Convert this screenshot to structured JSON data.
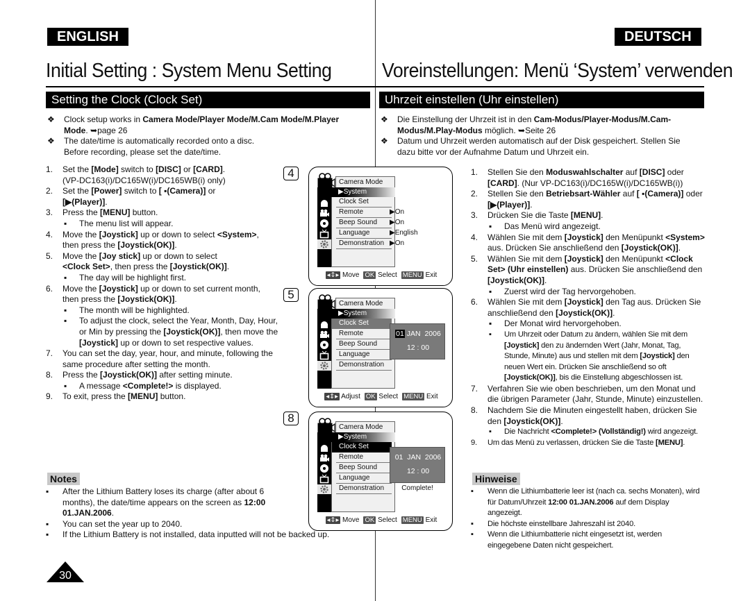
{
  "header": {
    "lang_left": "ENGLISH",
    "lang_right": "DEUTSCH",
    "title_en": "Initial Setting : System Menu Setting",
    "title_de": "Voreinstellungen: Menü ‘System’ verwenden",
    "section_en": "Setting the Clock (Clock Set)",
    "section_de": "Uhrzeit einstellen (Uhr einstellen)"
  },
  "en": {
    "intro": [
      {
        "pre": "Clock setup works in ",
        "bold": "Camera Mode/Player Mode/M.Cam Mode/M.Player Mode",
        "post": ". ➥page 26"
      },
      {
        "line1": "The date/time is automatically recorded onto a disc.",
        "line2": "Before recording, please set the date/time."
      }
    ],
    "steps": {
      "s1": {
        "num": "1.",
        "a": "Set the ",
        "b": "[Mode]",
        "c": " switch to ",
        "d": "[DISC]",
        "e": " or ",
        "f": "[CARD]",
        "g": ".",
        "line2": "(VP-DC163(i)/DC165W(i)/DC165WB(i) only)"
      },
      "s2": {
        "num": "2.",
        "a": "Set the ",
        "b": "[Power]",
        "c": " switch to ",
        "d": "[ ▪(Camera)]",
        "e": " or",
        "line2": "[▶(Player)]",
        "line2_post": "."
      },
      "s3": {
        "num": "3.",
        "a": "Press the ",
        "b": "[MENU]",
        "c": " button.",
        "sub": "The menu list will appear."
      },
      "s4": {
        "num": "4.",
        "a": "Move the ",
        "b": "[Joystick]",
        "c": " up or down to select ",
        "d": "<System>",
        "e": ",",
        "line2a": "then press the ",
        "line2b": "[Joystick(OK)]",
        "line2c": "."
      },
      "s5": {
        "num": "5.",
        "a": "Move the ",
        "b": "[Joy stick]",
        "c": " up or down to select",
        "line2a": "<Clock Set>",
        "line2b": ", then press the ",
        "line2c": "[Joystick(OK)]",
        "line2d": ".",
        "sub": "The day will be highlight first."
      },
      "s6": {
        "num": "6.",
        "a": "Move the ",
        "b": "[Joystick]",
        "c": " up or down to set current month,",
        "line2a": "then press the ",
        "line2b": "[Joystick(OK)]",
        "line2c": ".",
        "sub1": "The month will be highlighted.",
        "sub2a": "To adjust the clock, select the Year, Month, Day, Hour, or Min by pressing the ",
        "sub2b": "[Joystick(OK)]",
        "sub2c": ", then move the ",
        "sub2d": "[Joystick]",
        "sub2e": " up or down to set respective values."
      },
      "s7": {
        "num": "7.",
        "text": "You can set the day, year, hour, and minute, following the same procedure after setting the month."
      },
      "s8": {
        "num": "8.",
        "a": "Press the ",
        "b": "[Joystick(OK)]",
        "c": " after setting minute.",
        "suba": "A message ",
        "subb": "<Complete!>",
        "subc": " is displayed."
      },
      "s9": {
        "num": "9.",
        "a": "To exit, press the ",
        "b": "[MENU]",
        "c": " button."
      }
    },
    "notes_label": "Notes",
    "notes": {
      "n1a": "After the Lithium Battery loses its charge (after about 6 months), the date/time appears on the screen as ",
      "n1b": "12:00 01.JAN.2006",
      "n1c": ".",
      "n2": "You can set the year up to 2040.",
      "n3": "If the Lithium Battery is not installed, data inputted will not be backed up."
    }
  },
  "de": {
    "intro": [
      {
        "pre": "Die Einstellung der Uhrzeit ist in den ",
        "bold": "Cam-Modus/Player-Modus/M.Cam-Modus/M.Play-Modus",
        "post": " möglich. ➥Seite 26"
      },
      {
        "text": "Datum und Uhrzeit werden automatisch auf der Disk gespeichert. Stellen Sie dazu bitte vor der Aufnahme Datum und Uhrzeit ein."
      }
    ],
    "steps": {
      "s1": {
        "num": "1.",
        "a": "Stellen Sie den ",
        "b": "Moduswahlschalter",
        "c": " auf ",
        "d": "[DISC]",
        "e": " oder ",
        "f": "[CARD]",
        "g": ". (Nur VP-DC163(i)/DC165W(i)/DC165WB(i))"
      },
      "s2": {
        "num": "2.",
        "a": "Stellen Sie den ",
        "b": "Betriebsart-Wähler",
        "c": " auf ",
        "d": "[ ▪(Camera)]",
        "e": " oder ",
        "f": "[▶(Player)]",
        "g": "."
      },
      "s3": {
        "num": "3.",
        "a": "Drücken Sie die Taste ",
        "b": "[MENU]",
        "c": ".",
        "sub": "Das Menü wird angezeigt."
      },
      "s4": {
        "num": "4.",
        "a": "Wählen Sie mit dem ",
        "b": "[Joystick]",
        "c": " den Menüpunkt ",
        "d": "<System>",
        "e": " aus. Drücken Sie anschließend den ",
        "f": "[Joystick(OK)]",
        "g": "."
      },
      "s5": {
        "num": "5.",
        "a": "Wählen Sie mit dem ",
        "b": "[Joystick]",
        "c": " den Menüpunkt ",
        "d": "<Clock Set> (Uhr einstellen)",
        "e": " aus. Drücken Sie anschließend den ",
        "f": "[Joystick(OK)]",
        "g": ".",
        "sub": "Zuerst wird der Tag hervorgehoben."
      },
      "s6": {
        "num": "6.",
        "a": "Wählen Sie mit dem ",
        "b": "[Joystick]",
        "c": " den Tag aus. Drücken Sie anschließend den ",
        "d": "[Joystick(OK)]",
        "e": ".",
        "sub1": "Der Monat wird hervorgehoben.",
        "sub2a": "Um Uhrzeit oder Datum zu ändern, wählen Sie mit dem ",
        "sub2b": "[Joystick]",
        "sub2c": " den zu ändernden Wert (Jahr, Monat, Tag, Stunde, Minute) aus und stellen mit dem ",
        "sub2d": "[Joystick]",
        "sub2e": " den neuen Wert ein. Drücken Sie anschließend so oft ",
        "sub2f": "[Joystick(OK)]",
        "sub2g": ", bis die Einstellung abgeschlossen ist."
      },
      "s7": {
        "num": "7.",
        "text": "Verfahren Sie wie oben beschrieben, um den Monat und die übrigen Parameter (Jahr, Stunde, Minute) einzustellen."
      },
      "s8": {
        "num": "8.",
        "a": "Nachdem Sie die Minuten eingestellt haben, drücken Sie den ",
        "b": "[Joystick(OK)]",
        "c": ".",
        "suba": "Die Nachricht ",
        "subb": "<Complete!> (Vollständig!)",
        "subc": " wird angezeigt."
      },
      "s9": {
        "num": "9.",
        "a": "Um das Menü zu verlassen, drücken Sie die Taste ",
        "b": "[MENU]",
        "c": "."
      }
    },
    "notes_label": "Hinweise",
    "notes": {
      "n1a": "Wenn die Lithiumbatterie leer ist (nach ca. sechs Monaten), wird für Datum/Uhrzeit ",
      "n1b": "12:00 01.JAN.2006",
      "n1c": " auf dem Display angezeigt.",
      "n2": "Die höchste einstellbare Jahreszahl ist 2040.",
      "n3": "Wenn die Lithiumbatterie nicht eingesetzt ist, werden eingegebene Daten nicht gespeichert."
    }
  },
  "screens": [
    {
      "step": "4",
      "mode": "Camera Mode",
      "section": "System",
      "items": [
        "Clock Set",
        "Remote",
        "Beep Sound",
        "Language",
        "Demonstration"
      ],
      "values": [
        "On",
        "On",
        "English",
        "On"
      ],
      "footer": {
        "nav": "Move",
        "ok_key": "OK",
        "ok": "Select",
        "menu_key": "MENU",
        "menu": "Exit"
      }
    },
    {
      "step": "5",
      "mode": "Camera Mode",
      "section": "System",
      "items": [
        "Clock Set",
        "Remote",
        "Beep Sound",
        "Language",
        "Demonstration"
      ],
      "clock": {
        "day": "01",
        "month": "JAN",
        "year": "2006",
        "time": "12 : 00"
      },
      "footer": {
        "nav": "Adjust",
        "ok_key": "OK",
        "ok": "Select",
        "menu_key": "MENU",
        "menu": "Exit"
      }
    },
    {
      "step": "8",
      "mode": "Camera Mode",
      "section": "System",
      "items": [
        "Clock Set",
        "Remote",
        "Beep Sound",
        "Language",
        "Demonstration"
      ],
      "clock": {
        "date": "01  JAN  2006",
        "time": "12 : 00"
      },
      "message": "Complete!",
      "footer": {
        "nav": "Move",
        "ok_key": "OK",
        "ok": "Select",
        "menu_key": "MENU",
        "menu": "Exit"
      }
    }
  ],
  "page_number": "30",
  "icons": {
    "bullet_intro": "❖",
    "bullet_sub": "▪",
    "arrow": "▶"
  }
}
